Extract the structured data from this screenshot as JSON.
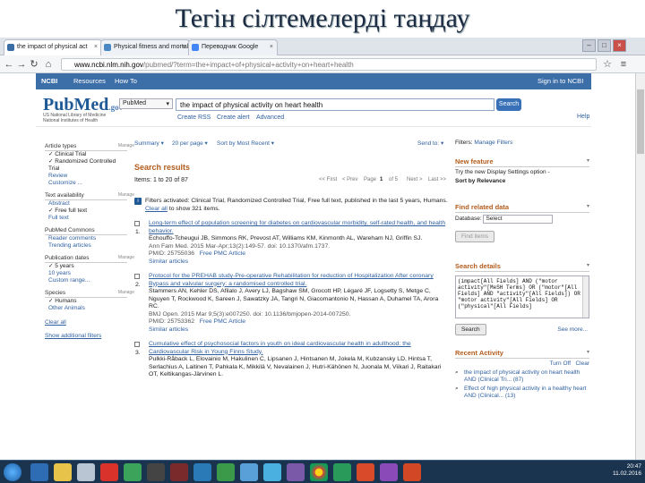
{
  "slide": {
    "title": "Тегін сілтемелерді таңдау"
  },
  "browser": {
    "tabs": [
      {
        "label": "the impact of physical act",
        "color": "#3a6ea5"
      },
      {
        "label": "Physical fitness and mortal",
        "color": "#4a88c5"
      },
      {
        "label": "Переводчик Google",
        "color": "#4285f4"
      }
    ],
    "url_host": "www.ncbi.nlm.nih.gov",
    "url_path": "/pubmed/?term=the+impact+of+physical+activity+on+heart+health"
  },
  "ncbi": {
    "brand": "NCBI",
    "resources": "Resources",
    "howto": "How To",
    "signin": "Sign in to NCBI"
  },
  "pubmed": {
    "logo": "PubMed",
    "logo_suffix": ".gov",
    "logo_sub1": "US National Library of Medicine",
    "logo_sub2": "National Institutes of Health",
    "db": "PubMed",
    "query": "the impact of physical activity on heart health",
    "search_btn": "Search",
    "create_rss": "Create RSS",
    "create_alert": "Create alert",
    "advanced": "Advanced",
    "help": "Help"
  },
  "filters": {
    "article_types_head": "Article types",
    "article_types": [
      "Clinical Trial",
      "Randomized Controlled Trial",
      "Review",
      "Customize ..."
    ],
    "text_head": "Text availability",
    "text_items": [
      "Abstract",
      "Free full text",
      "Full text"
    ],
    "commons_head": "PubMed Commons",
    "commons_items": [
      "Reader comments",
      "Trending articles"
    ],
    "date_head": "Publication dates",
    "date_items": [
      "5 years",
      "10 years",
      "Custom range..."
    ],
    "species_head": "Species",
    "species_items": [
      "Humans",
      "Other Animals"
    ],
    "clear": "Clear all",
    "show_more": "Show additional filters",
    "manage": "Manage"
  },
  "toolbar": {
    "summary": "Summary ▾",
    "per_page": "20 per page ▾",
    "sort": "Sort by Most Recent ▾",
    "send_to": "Send to: ▾",
    "filters_label": "Filters:",
    "manage_filters": "Manage Filters"
  },
  "results": {
    "heading": "Search results",
    "count": "Items: 1 to 20 of 87",
    "first": "<< First",
    "prev": "< Prev",
    "page": "Page",
    "page_num": "1",
    "of": "of 5",
    "next": "Next >",
    "last": "Last >>",
    "notice": "Filters activated: Clinical Trial, Randomized Controlled Trial, Free full text, published in the last 5 years, Humans.",
    "notice_clear": "Clear all",
    "notice_tail": "to show 321 items.",
    "items": [
      {
        "num": "1.",
        "title": "Long-term effect of population screening for diabetes on cardiovascular morbidity, self-rated health, and health behavior.",
        "authors": "Echouffo-Tcheugui JB, Simmons RK, Prevost AT, Williams KM, Kinmonth AL, Wareham NJ, Griffin SJ.",
        "journal": "Ann Fam Med. 2015 Mar-Apr;13(2):149-57. doi: 10.1370/afm.1737.",
        "pmid": "PMID: 25755036",
        "free": "Free PMC Article",
        "similar": "Similar articles"
      },
      {
        "num": "2.",
        "title": "Protocol for the PREHAB study-Pre-operative Rehabilitation for reduction of Hospitalization After coronary Bypass and valvular surgery: a randomised controlled trial.",
        "authors": "Stammers AN, Kehler DS, Afilalo J, Avery LJ, Bagshaw SM, Grocott HP, Légaré JF, Logsetty S, Metge C, Nguyen T, Rockwood K, Sareen J, Sawatzky JA, Tangri N, Giacomantonio N, Hassan A, Duhamel TA, Arora RC.",
        "journal": "BMJ Open. 2015 Mar 9;5(3):e007250. doi: 10.1136/bmjopen-2014-007250.",
        "pmid": "PMID: 25753362",
        "free": "Free PMC Article",
        "similar": "Similar articles"
      },
      {
        "num": "3.",
        "title": "Cumulative effect of psychosocial factors in youth on ideal cardiovascular health in adulthood: the Cardiovascular Risk in Young Finns Study.",
        "authors": "Pulkki-Råback L, Elovainio M, Hakulinen C, Lipsanen J, Hintsanen M, Jokela M, Kubzansky LD, Hintsa T, Serlachius A, Laitinen T, Pahkala K, Mikkilä V, Nevalainen J, Hutri-Kähönen N, Juonala M, Viikari J, Raitakari OT, Keltikangas-Järvinen L."
      }
    ]
  },
  "right": {
    "feature_head": "New feature",
    "feature_text": "Try the new Display Settings option -",
    "feature_link": "Sort by Relevance",
    "related_head": "Find related data",
    "db_label": "Database:",
    "db_value": "Select",
    "find_items": "Find items",
    "details_head": "Search details",
    "details_text": "(impact[All Fields] AND (\"motor activity\"[MeSH Terms] OR (\"motor\"[All Fields] AND \"activity\"[All Fields]) OR \"motor activity\"[All Fields] OR (\"physical\"[All Fields]",
    "search_btn": "Search",
    "see_more": "See more...",
    "recent_head": "Recent Activity",
    "turn_off": "Turn Off",
    "clear": "Clear",
    "recent_items": [
      "the impact of physical activity on heart health AND (Clinical Tri... (87)",
      "Effect of high physical activity in a healthy heart AND (Clinical... (13)"
    ]
  },
  "taskbar": {
    "time": "20:47",
    "date": "11.02.2016"
  }
}
